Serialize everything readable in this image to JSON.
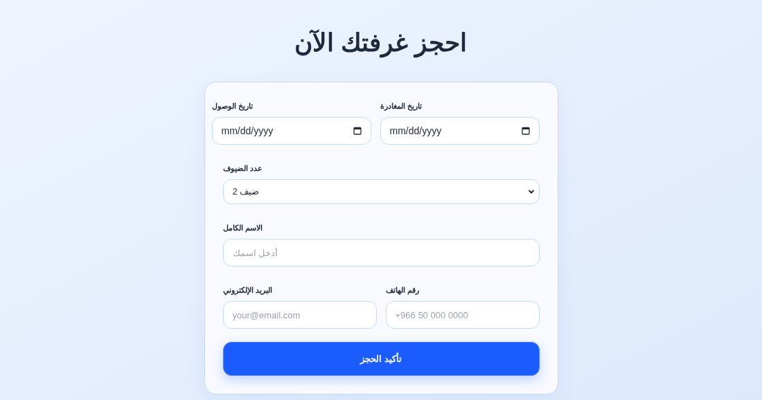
{
  "title": "احجز غرفتك الآن",
  "rows": [
    {
      "fields": [
        {
          "kind": "date",
          "label": "تاريخ المغادرة",
          "placeholder": "mm/dd/yyyy"
        },
        {
          "kind": "date",
          "label": "تاريخ الوصول",
          "placeholder": "mm/dd/yyyy"
        }
      ]
    },
    {
      "fields": [
        {
          "kind": "select",
          "label": "عدد الضيوف",
          "value": "ضيف 2"
        }
      ]
    },
    {
      "fields": [
        {
          "kind": "text",
          "label": "الاسم الكامل",
          "placeholder": "أدخل اسمك"
        }
      ]
    },
    {
      "fields": [
        {
          "kind": "text",
          "label": "رقم الهاتف",
          "placeholder": "+966 50 000 0000"
        },
        {
          "kind": "text",
          "label": "البريد الإلكتروني",
          "placeholder": "your@email.com"
        }
      ]
    }
  ],
  "submit": "تأكيد الحجز"
}
